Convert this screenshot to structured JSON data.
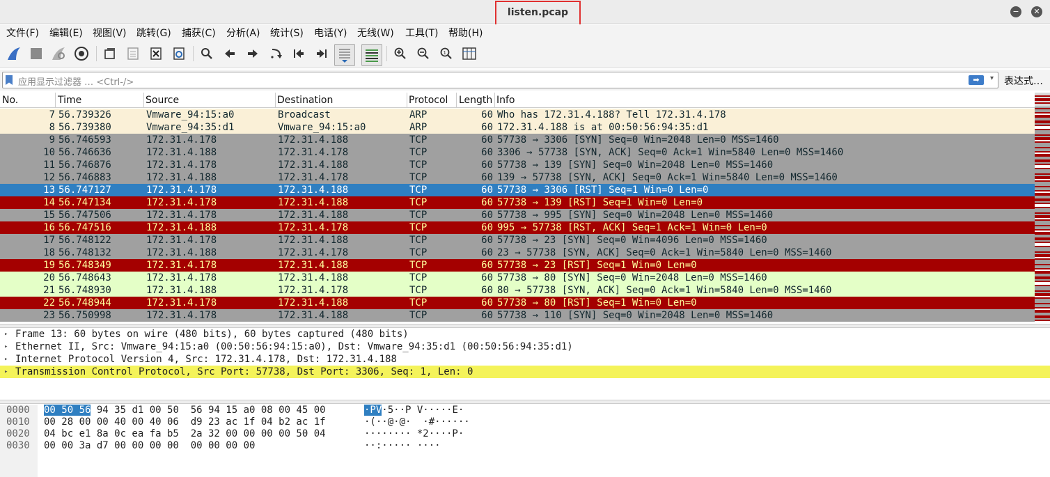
{
  "window": {
    "title": "listen.pcap",
    "minimize_glyph": "−",
    "close_glyph": "✕"
  },
  "menu": [
    {
      "label": "文件(F)"
    },
    {
      "label": "编辑(E)"
    },
    {
      "label": "视图(V)"
    },
    {
      "label": "跳转(G)"
    },
    {
      "label": "捕获(C)"
    },
    {
      "label": "分析(A)"
    },
    {
      "label": "统计(S)"
    },
    {
      "label": "电话(Y)"
    },
    {
      "label": "无线(W)"
    },
    {
      "label": "工具(T)"
    },
    {
      "label": "帮助(H)"
    }
  ],
  "toolbar": {
    "icons": [
      "shark-fin-start-icon",
      "stop-capture-icon",
      "restart-capture-icon",
      "capture-options-gear-icon",
      "open-file-icon",
      "save-file-icon",
      "close-file-icon",
      "reload-file-icon",
      "find-packet-icon",
      "go-back-icon",
      "go-forward-icon",
      "go-to-packet-icon",
      "first-packet-icon",
      "last-packet-icon",
      "auto-scroll-icon",
      "colorize-icon",
      "zoom-in-icon",
      "zoom-out-icon",
      "normal-size-icon",
      "resize-columns-icon"
    ]
  },
  "filter": {
    "placeholder": "应用显示过滤器 … <Ctrl-/>",
    "apply_glyph": "➡",
    "dropdown_glyph": "▾",
    "expression_label": "表达式…"
  },
  "columns": [
    "No.",
    "Time",
    "Source",
    "Destination",
    "Protocol",
    "Length",
    "Info"
  ],
  "packets": [
    {
      "no": "7",
      "time": "56.739326",
      "src": "Vmware_94:15:a0",
      "dst": "Broadcast",
      "proto": "ARP",
      "len": "60",
      "info": "Who has 172.31.4.188? Tell 172.31.4.178",
      "bg": "#faf0d7",
      "fg": "#12272e"
    },
    {
      "no": "8",
      "time": "56.739380",
      "src": "Vmware_94:35:d1",
      "dst": "Vmware_94:15:a0",
      "proto": "ARP",
      "len": "60",
      "info": "172.31.4.188 is at 00:50:56:94:35:d1",
      "bg": "#faf0d7",
      "fg": "#12272e"
    },
    {
      "no": "9",
      "time": "56.746593",
      "src": "172.31.4.178",
      "dst": "172.31.4.188",
      "proto": "TCP",
      "len": "60",
      "info": "57738 → 3306 [SYN] Seq=0 Win=2048 Len=0 MSS=1460",
      "bg": "#a0a0a0",
      "fg": "#12272e"
    },
    {
      "no": "10",
      "time": "56.746636",
      "src": "172.31.4.188",
      "dst": "172.31.4.178",
      "proto": "TCP",
      "len": "60",
      "info": "3306 → 57738 [SYN, ACK] Seq=0 Ack=1 Win=5840 Len=0 MSS=1460",
      "bg": "#a0a0a0",
      "fg": "#12272e"
    },
    {
      "no": "11",
      "time": "56.746876",
      "src": "172.31.4.178",
      "dst": "172.31.4.188",
      "proto": "TCP",
      "len": "60",
      "info": "57738 → 139 [SYN] Seq=0 Win=2048 Len=0 MSS=1460",
      "bg": "#a0a0a0",
      "fg": "#12272e"
    },
    {
      "no": "12",
      "time": "56.746883",
      "src": "172.31.4.188",
      "dst": "172.31.4.178",
      "proto": "TCP",
      "len": "60",
      "info": "139 → 57738 [SYN, ACK] Seq=0 Ack=1 Win=5840 Len=0 MSS=1460",
      "bg": "#a0a0a0",
      "fg": "#12272e"
    },
    {
      "no": "13",
      "time": "56.747127",
      "src": "172.31.4.178",
      "dst": "172.31.4.188",
      "proto": "TCP",
      "len": "60",
      "info": "57738 → 3306 [RST] Seq=1 Win=0 Len=0",
      "bg": "#2f7fc1",
      "fg": "#ffffff"
    },
    {
      "no": "14",
      "time": "56.747134",
      "src": "172.31.4.178",
      "dst": "172.31.4.188",
      "proto": "TCP",
      "len": "60",
      "info": "57738 → 139 [RST] Seq=1 Win=0 Len=0",
      "bg": "#a40000",
      "fg": "#fffc9c"
    },
    {
      "no": "15",
      "time": "56.747506",
      "src": "172.31.4.178",
      "dst": "172.31.4.188",
      "proto": "TCP",
      "len": "60",
      "info": "57738 → 995 [SYN] Seq=0 Win=2048 Len=0 MSS=1460",
      "bg": "#a0a0a0",
      "fg": "#12272e"
    },
    {
      "no": "16",
      "time": "56.747516",
      "src": "172.31.4.188",
      "dst": "172.31.4.178",
      "proto": "TCP",
      "len": "60",
      "info": "995 → 57738 [RST, ACK] Seq=1 Ack=1 Win=0 Len=0",
      "bg": "#a40000",
      "fg": "#fffc9c"
    },
    {
      "no": "17",
      "time": "56.748122",
      "src": "172.31.4.178",
      "dst": "172.31.4.188",
      "proto": "TCP",
      "len": "60",
      "info": "57738 → 23 [SYN] Seq=0 Win=4096 Len=0 MSS=1460",
      "bg": "#a0a0a0",
      "fg": "#12272e"
    },
    {
      "no": "18",
      "time": "56.748132",
      "src": "172.31.4.188",
      "dst": "172.31.4.178",
      "proto": "TCP",
      "len": "60",
      "info": "23 → 57738 [SYN, ACK] Seq=0 Ack=1 Win=5840 Len=0 MSS=1460",
      "bg": "#a0a0a0",
      "fg": "#12272e"
    },
    {
      "no": "19",
      "time": "56.748349",
      "src": "172.31.4.178",
      "dst": "172.31.4.188",
      "proto": "TCP",
      "len": "60",
      "info": "57738 → 23 [RST] Seq=1 Win=0 Len=0",
      "bg": "#a40000",
      "fg": "#fffc9c"
    },
    {
      "no": "20",
      "time": "56.748643",
      "src": "172.31.4.178",
      "dst": "172.31.4.188",
      "proto": "TCP",
      "len": "60",
      "info": "57738 → 80 [SYN] Seq=0 Win=2048 Len=0 MSS=1460",
      "bg": "#e4ffc7",
      "fg": "#12272e"
    },
    {
      "no": "21",
      "time": "56.748930",
      "src": "172.31.4.188",
      "dst": "172.31.4.178",
      "proto": "TCP",
      "len": "60",
      "info": "80 → 57738 [SYN, ACK] Seq=0 Ack=1 Win=5840 Len=0 MSS=1460",
      "bg": "#e4ffc7",
      "fg": "#12272e"
    },
    {
      "no": "22",
      "time": "56.748944",
      "src": "172.31.4.178",
      "dst": "172.31.4.188",
      "proto": "TCP",
      "len": "60",
      "info": "57738 → 80 [RST] Seq=1 Win=0 Len=0",
      "bg": "#a40000",
      "fg": "#fffc9c"
    },
    {
      "no": "23",
      "time": "56.750998",
      "src": "172.31.4.178",
      "dst": "172.31.4.188",
      "proto": "TCP",
      "len": "60",
      "info": "57738 → 110 [SYN] Seq=0 Win=2048 Len=0 MSS=1460",
      "bg": "#a0a0a0",
      "fg": "#12272e"
    }
  ],
  "selected_packet": "13",
  "details": [
    {
      "text": "Frame 13: 60 bytes on wire (480 bits), 60 bytes captured (480 bits)",
      "highlight": false
    },
    {
      "text": "Ethernet II, Src: Vmware_94:15:a0 (00:50:56:94:15:a0), Dst: Vmware_94:35:d1 (00:50:56:94:35:d1)",
      "highlight": false
    },
    {
      "text": "Internet Protocol Version 4, Src: 172.31.4.178, Dst: 172.31.4.188",
      "highlight": false
    },
    {
      "text": "Transmission Control Protocol, Src Port: 57738, Dst Port: 3306, Seq: 1, Len: 0",
      "highlight": true
    }
  ],
  "details_expander_glyph": "▸",
  "bytes": [
    {
      "offset": "0000",
      "hex_sel": "00 50 56",
      "hex_rest": " 94 35 d1 00 50  56 94 15 a0 08 00 45 00",
      "ascii_sel": "·PV",
      "ascii_rest": "·5··P V·····E·"
    },
    {
      "offset": "0010",
      "hex_sel": "",
      "hex_rest": "00 28 00 00 40 00 40 06  d9 23 ac 1f 04 b2 ac 1f",
      "ascii_sel": "",
      "ascii_rest": "·(··@·@·  ·#······"
    },
    {
      "offset": "0020",
      "hex_sel": "",
      "hex_rest": "04 bc e1 8a 0c ea fa b5  2a 32 00 00 00 00 50 04",
      "ascii_sel": "",
      "ascii_rest": "········ *2····P·"
    },
    {
      "offset": "0030",
      "hex_sel": "",
      "hex_rest": "00 00 3a d7 00 00 00 00  00 00 00 00",
      "ascii_sel": "",
      "ascii_rest": "··:····· ····"
    }
  ],
  "colors": {
    "selected": "#2f7fc1",
    "rst": "#a40000",
    "tcp": "#a0a0a0",
    "arp": "#faf0d7",
    "http": "#e4ffc7",
    "detail_highlight": "#f4f35a"
  }
}
